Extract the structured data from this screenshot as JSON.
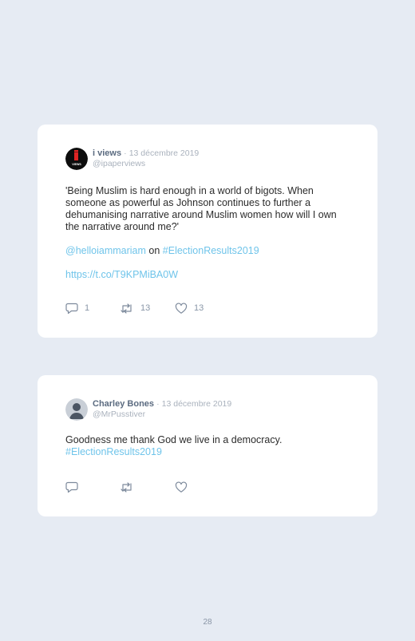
{
  "tweets": [
    {
      "author": "i views",
      "separator": "·",
      "date": "13 décembre 2019",
      "handle": "@ipaperviews",
      "avatar_text": "VIEWS",
      "text": "'Being Muslim is hard enough in a world of bigots. When someone as powerful as Johnson continues to further a dehumanising narrative around Muslim women how will I own the narrative around me?'",
      "mention": "@helloiammariam",
      "mention_joiner": " on ",
      "hashtag": "#ElectionResults2019",
      "url": "https://t.co/T9KPMiBA0W",
      "replies": "1",
      "retweets": "13",
      "likes": "13"
    },
    {
      "author": "Charley Bones",
      "separator": "·",
      "date": "13 décembre 2019",
      "handle": "@MrPusstiver",
      "text": "Goodness me thank God we live in a democracy.",
      "hashtag": "#ElectionResults2019"
    }
  ],
  "page_number": "28",
  "colors": {
    "background": "#e6ebf3",
    "card": "#ffffff",
    "link": "#6fc4ea",
    "author": "#5b6b80",
    "muted": "#aab2bd",
    "icon": "#7d8a9c"
  },
  "icons": [
    "reply-icon",
    "retweet-icon",
    "like-icon"
  ]
}
